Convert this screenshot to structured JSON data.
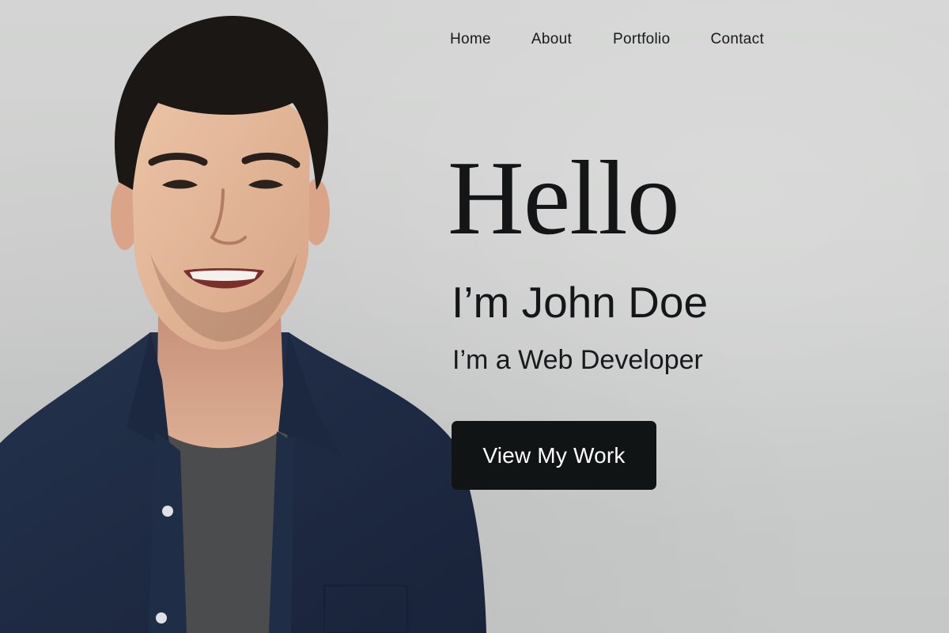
{
  "nav": {
    "items": [
      {
        "label": "Home"
      },
      {
        "label": "About"
      },
      {
        "label": "Portfolio"
      },
      {
        "label": "Contact"
      }
    ]
  },
  "hero": {
    "greeting": "Hello",
    "name": "I’m John Doe",
    "role": "I’m a Web Developer",
    "cta_label": "View My Work"
  },
  "photo": {
    "subject": "portrait-of-smiling-man-in-navy-shirt"
  },
  "colors": {
    "background": "#cfd0cf",
    "text": "#141617",
    "button_bg": "#111415",
    "button_text": "#ffffff",
    "shirt": "#1f2d45",
    "tshirt": "#4a4c4d",
    "skin": "#e2b497",
    "hair": "#1b1715"
  }
}
